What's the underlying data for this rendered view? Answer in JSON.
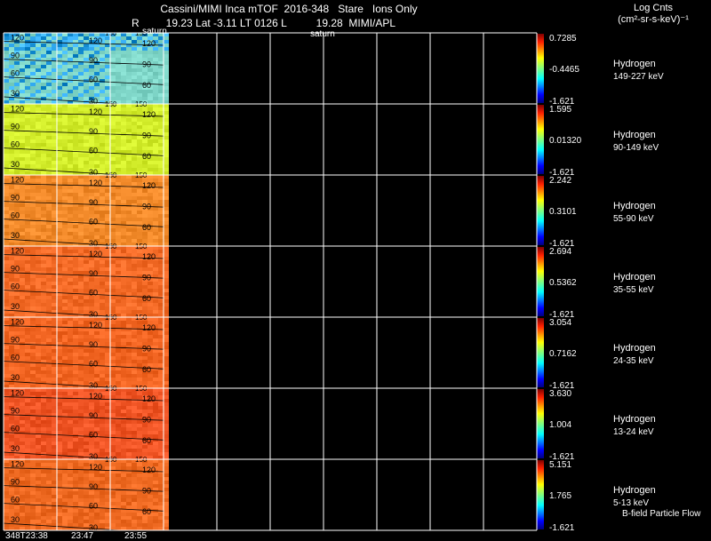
{
  "header": {
    "title": "Cassini/MIMI Inca mTOF  2016-348   Stare   Ions Only",
    "subtitle": "R         19.23 Lat -3.11 LT 0126 L          19.28  MIMI/APL",
    "units_line1": "Log Cnts",
    "units_line2": "(cm²-sr-s-keV)⁻¹",
    "footer_note": "B-field Particle Flow"
  },
  "colors": {
    "background": "#000000",
    "grid": "#ffffff",
    "contour": "#000000"
  },
  "chart_data": {
    "type": "heatmap",
    "time_labels": [
      "348T23:38",
      "23:47",
      "23:55"
    ],
    "saturn_labels": [
      "saturn",
      "saturn"
    ],
    "contour_labels": [
      "150",
      "120",
      "90",
      "60",
      "30"
    ],
    "panels": [
      {
        "species": "Hydrogen",
        "energy": "149-227 keV",
        "max": "0.7285",
        "mid": "-0.4465",
        "min": "-1.621",
        "base_color": "#7fd6c8"
      },
      {
        "species": "Hydrogen",
        "energy": "90-149 keV",
        "max": "1.595",
        "mid": "0.01320",
        "min": "-1.621",
        "base_color": "#d2ec2a"
      },
      {
        "species": "Hydrogen",
        "energy": "55-90 keV",
        "max": "2.242",
        "mid": "0.3101",
        "min": "-1.621",
        "base_color": "#f28a2a"
      },
      {
        "species": "Hydrogen",
        "energy": "35-55 keV",
        "max": "2.694",
        "mid": "0.5362",
        "min": "-1.621",
        "base_color": "#f36a26"
      },
      {
        "species": "Hydrogen",
        "energy": "24-35 keV",
        "max": "3.054",
        "mid": "0.7162",
        "min": "-1.621",
        "base_color": "#f26522"
      },
      {
        "species": "Hydrogen",
        "energy": "13-24 keV",
        "max": "3.630",
        "mid": "1.004",
        "min": "-1.621",
        "base_color": "#ef5424"
      },
      {
        "species": "Hydrogen",
        "energy": "5-13 keV",
        "max": "5.151",
        "mid": "1.765",
        "min": "-1.621",
        "base_color": "#ef6a22"
      }
    ]
  }
}
